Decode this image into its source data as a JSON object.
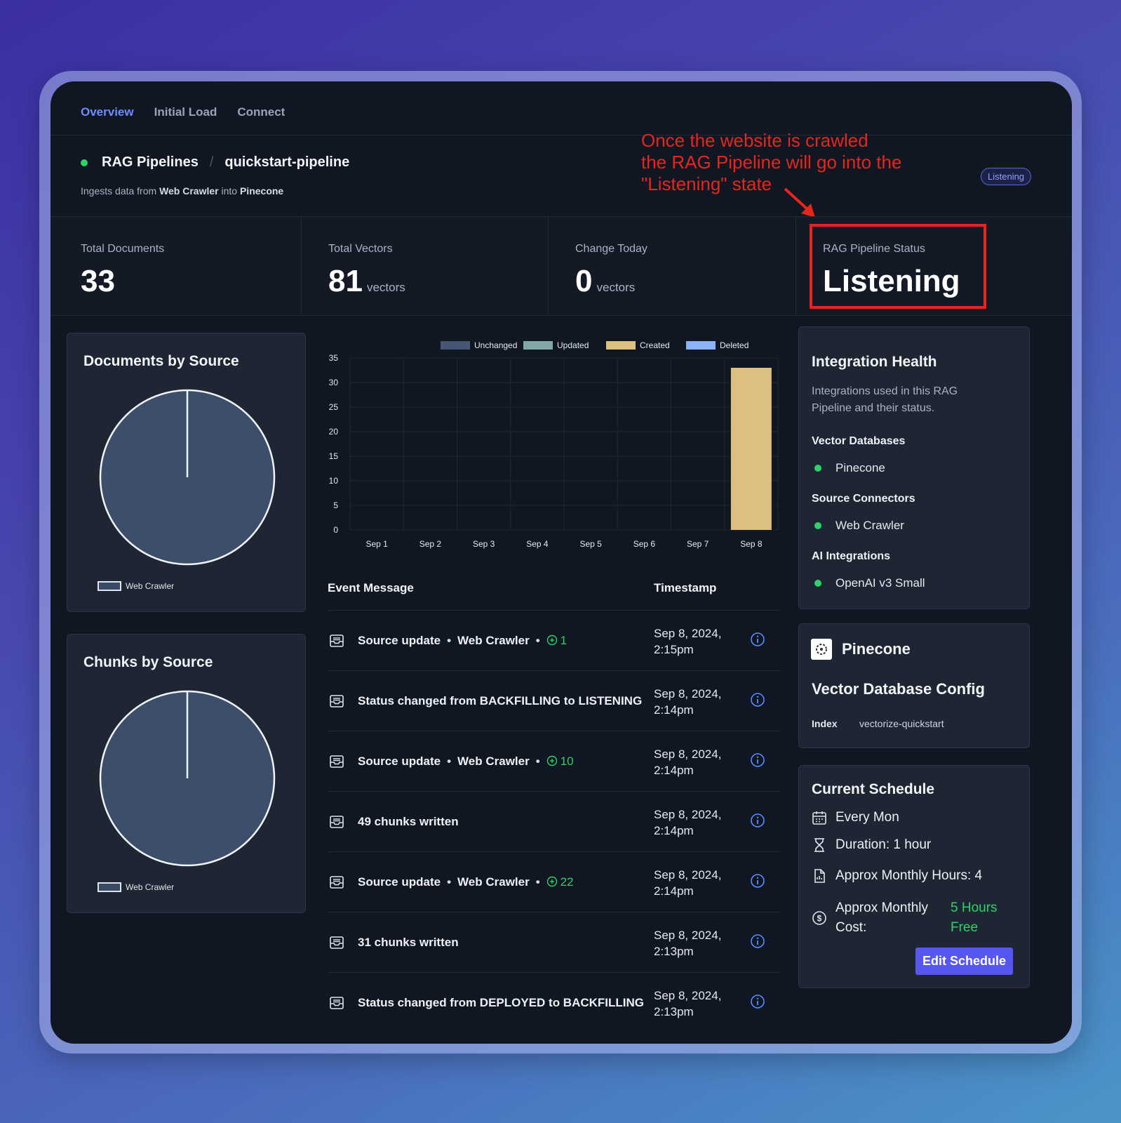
{
  "tabs": [
    {
      "label": "Overview",
      "active": true
    },
    {
      "label": "Initial Load",
      "active": false
    },
    {
      "label": "Connect",
      "active": false
    }
  ],
  "header": {
    "breadcrumb_root": "RAG Pipelines",
    "breadcrumb_sep": "/",
    "pipeline_name": "quickstart-pipeline",
    "ingest_prefix": "Ingests data from",
    "ingest_source": "Web Crawler",
    "ingest_mid": "into",
    "ingest_target": "Pinecone",
    "status_badge": "Listening",
    "status_color": "#2fd16a"
  },
  "annotation": {
    "line1": "Once the website is crawled",
    "line2": "the RAG Pipeline will go into the",
    "line3": "\"Listening\" state",
    "color": "#e5261d"
  },
  "stats": {
    "total_documents": {
      "label": "Total Documents",
      "value": "33"
    },
    "total_vectors": {
      "label": "Total Vectors",
      "value": "81",
      "unit": "vectors"
    },
    "change_today": {
      "label": "Change Today",
      "value": "0",
      "unit": "vectors"
    },
    "pipeline_status": {
      "label": "RAG Pipeline Status",
      "value": "Listening"
    }
  },
  "documents_by_source": {
    "title": "Documents by Source",
    "legend": "Web Crawler"
  },
  "chunks_by_source": {
    "title": "Chunks by Source",
    "legend": "Web Crawler"
  },
  "chart_data": [
    {
      "type": "pie",
      "title": "Documents by Source",
      "labels": [
        "Web Crawler"
      ],
      "values": [
        100
      ],
      "colors": [
        "#3d4e6b"
      ]
    },
    {
      "type": "pie",
      "title": "Chunks by Source",
      "labels": [
        "Web Crawler"
      ],
      "values": [
        100
      ],
      "colors": [
        "#3d4e6b"
      ]
    },
    {
      "type": "bar",
      "stacked": true,
      "categories": [
        "Sep 1",
        "Sep 2",
        "Sep 3",
        "Sep 4",
        "Sep 5",
        "Sep 6",
        "Sep 7",
        "Sep 8"
      ],
      "series": [
        {
          "name": "Unchanged",
          "color": "#475675",
          "values": [
            0,
            0,
            0,
            0,
            0,
            0,
            0,
            0
          ]
        },
        {
          "name": "Updated",
          "color": "#83a7a8",
          "values": [
            0,
            0,
            0,
            0,
            0,
            0,
            0,
            0
          ]
        },
        {
          "name": "Created",
          "color": "#dcc080",
          "values": [
            0,
            0,
            0,
            0,
            0,
            0,
            0,
            33
          ]
        },
        {
          "name": "Deleted",
          "color": "#8ab4f5",
          "values": [
            0,
            0,
            0,
            0,
            0,
            0,
            0,
            0
          ]
        }
      ],
      "yticks": [
        "0",
        "5",
        "10",
        "15",
        "20",
        "25",
        "30",
        "35"
      ],
      "ylim": [
        0,
        35
      ],
      "legend_position": "top",
      "grid": true
    }
  ],
  "events": {
    "header_message": "Event Message",
    "header_timestamp": "Timestamp",
    "rows": [
      {
        "type": "source",
        "label": "Source update",
        "source": "Web Crawler",
        "count": "1",
        "ts1": "Sep 8, 2024,",
        "ts2": "2:15pm"
      },
      {
        "type": "plain",
        "label": "Status changed from BACKFILLING to LISTENING",
        "ts1": "Sep 8, 2024,",
        "ts2": "2:14pm"
      },
      {
        "type": "source",
        "label": "Source update",
        "source": "Web Crawler",
        "count": "10",
        "ts1": "Sep 8, 2024,",
        "ts2": "2:14pm"
      },
      {
        "type": "plain",
        "label": "49 chunks written",
        "ts1": "Sep 8, 2024,",
        "ts2": "2:14pm"
      },
      {
        "type": "source",
        "label": "Source update",
        "source": "Web Crawler",
        "count": "22",
        "ts1": "Sep 8, 2024,",
        "ts2": "2:14pm"
      },
      {
        "type": "plain",
        "label": "31 chunks written",
        "ts1": "Sep 8, 2024,",
        "ts2": "2:13pm"
      },
      {
        "type": "plain",
        "label": "Status changed from DEPLOYED to BACKFILLING",
        "ts1": "Sep 8, 2024,",
        "ts2": "2:13pm"
      }
    ]
  },
  "integration_health": {
    "title": "Integration Health",
    "description_line1": "Integrations used in this RAG",
    "description_line2": "Pipeline and their status.",
    "vector_db_title": "Vector Databases",
    "vector_db_item": "Pinecone",
    "source_title": "Source Connectors",
    "source_item": "Web Crawler",
    "ai_title": "AI Integrations",
    "ai_item": "OpenAI v3 Small"
  },
  "pinecone_card": {
    "name": "Pinecone",
    "title": "Vector Database Config",
    "index_label": "Index",
    "index_value": "vectorize-quickstart"
  },
  "schedule": {
    "title": "Current Schedule",
    "every": "Every Mon",
    "duration": "Duration: 1 hour",
    "monthly_hours": "Approx Monthly Hours: 4",
    "cost_label_1": "Approx Monthly",
    "cost_label_2": "Cost:",
    "cost_value_1": "5 Hours",
    "cost_value_2": "Free",
    "cost_color": "#2fd16a",
    "edit_button": "Edit Schedule"
  }
}
